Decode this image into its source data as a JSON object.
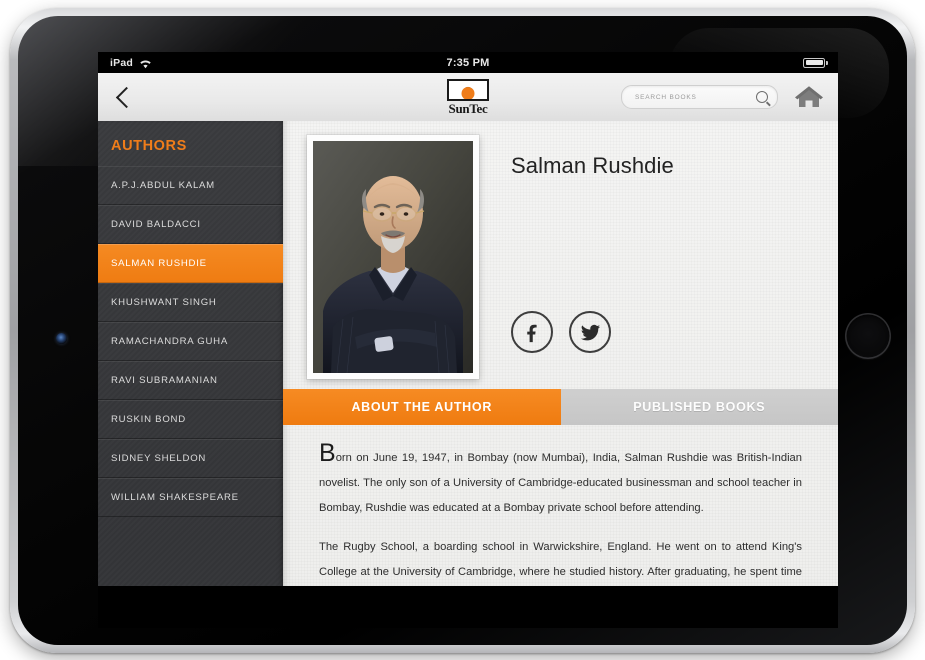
{
  "device": {
    "name": "iPad"
  },
  "status_bar": {
    "carrier": "iPad",
    "wifi_icon": "wifi-icon",
    "time": "7:35 PM",
    "battery_icon": "battery-icon"
  },
  "navbar": {
    "back_icon": "back-chevron-icon",
    "logo_text": "SunTec",
    "logo_icon": "suntec-sun-logo-icon",
    "home_icon": "home-icon",
    "search": {
      "placeholder": "SEARCH BOOKS",
      "value": "",
      "icon": "search-magnifier-icon"
    }
  },
  "sidebar": {
    "title": "AUTHORS",
    "items": [
      {
        "label": "A.P.J.ABDUL KALAM",
        "active": false
      },
      {
        "label": "DAVID BALDACCI",
        "active": false
      },
      {
        "label": "SALMAN RUSHDIE",
        "active": true
      },
      {
        "label": "KHUSHWANT SINGH",
        "active": false
      },
      {
        "label": "RAMACHANDRA GUHA",
        "active": false
      },
      {
        "label": "RAVI SUBRAMANIAN",
        "active": false
      },
      {
        "label": "RUSKIN BOND",
        "active": false
      },
      {
        "label": "SIDNEY SHELDON",
        "active": false
      },
      {
        "label": "WILLIAM SHAKESPEARE",
        "active": false
      }
    ]
  },
  "author": {
    "name": "Salman Rushdie",
    "photo_alt": "Salman Rushdie portrait photograph",
    "socials": [
      {
        "name": "facebook",
        "glyph": "f"
      },
      {
        "name": "twitter",
        "glyph": "bird"
      }
    ]
  },
  "tabs": [
    {
      "label": "ABOUT THE AUTHOR",
      "active": true
    },
    {
      "label": "PUBLISHED BOOKS",
      "active": false
    }
  ],
  "about": {
    "paragraphs": [
      "Born on June 19, 1947, in Bombay (now Mumbai), India, Salman Rushdie was British-Indian novelist. The only son of a University of Cambridge-educated businessman and school teacher in Bombay, Rushdie was educated at a Bombay private school before attending.",
      "The Rugby School, a boarding school in Warwickshire, England. He went on to attend King's College at the University of Cambridge, where he studied history. After graduating, he spent time working in television and a brief period as a copywriter for an advertising agency, before pursuing a career as"
    ]
  },
  "colors": {
    "accent_orange": "#ef7c12",
    "sidebar_dark": "#36373a",
    "tab_inactive": "#c9c9c9",
    "text_dark": "#2e2e2e"
  }
}
